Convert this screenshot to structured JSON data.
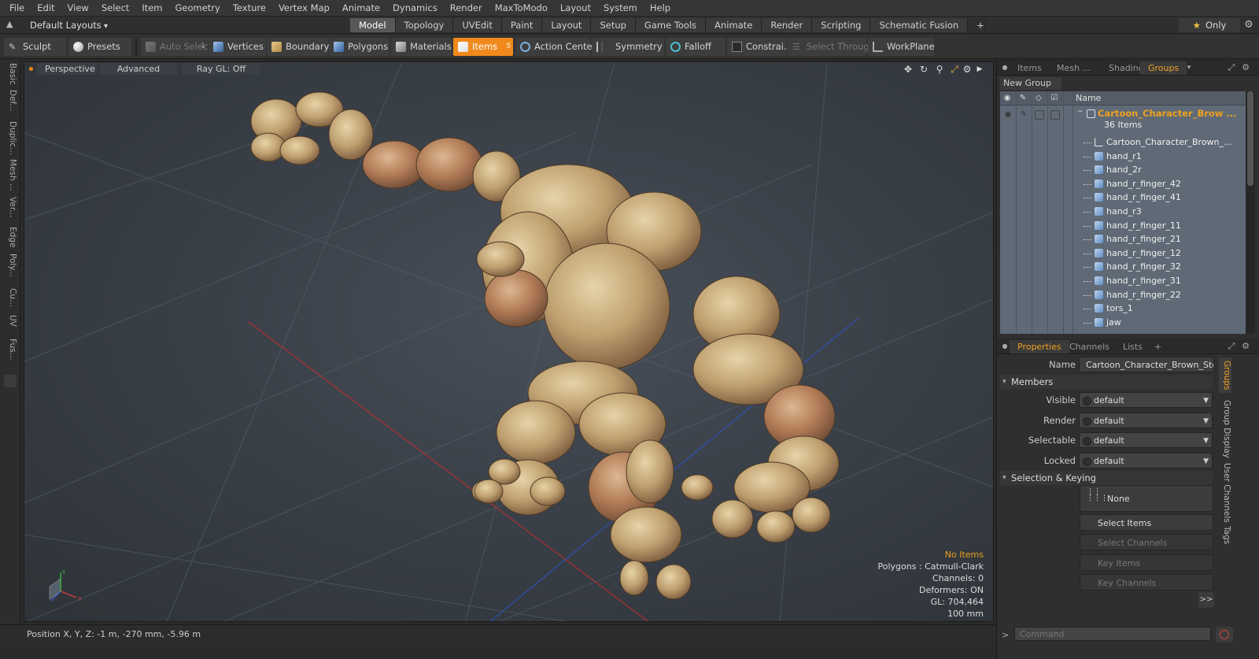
{
  "menubar": [
    "File",
    "Edit",
    "View",
    "Select",
    "Item",
    "Geometry",
    "Texture",
    "Vertex Map",
    "Animate",
    "Dynamics",
    "Render",
    "MaxToModo",
    "Layout",
    "System",
    "Help"
  ],
  "layoutbar": {
    "layout_name": "Default Layouts",
    "tabs": [
      "Model",
      "Topology",
      "UVEdit",
      "Paint",
      "Layout",
      "Setup",
      "Game Tools",
      "Animate",
      "Render",
      "Scripting",
      "Schematic Fusion"
    ],
    "active_tab": "Model",
    "add_tab_label": "+",
    "only_label": "Only"
  },
  "toolbar": {
    "sculpt": "Sculpt",
    "presets": "Presets",
    "auto_select": "Auto Select",
    "auto_select_num": "1",
    "vertices": "Vertices",
    "boundary": "Boundary",
    "polygons": "Polygons",
    "materials": "Materials",
    "items": "Items",
    "items_num": "5",
    "action_center": "Action Center",
    "symmetry": "Symmetry",
    "falloff": "Falloff",
    "constraints": "Constrai...",
    "select_through": "Select Through",
    "workplane": "WorkPlane"
  },
  "left_tabs": [
    "Basic",
    "Def...",
    "Duplic...",
    "Mesh ...",
    "Ver...",
    "Edge",
    "Poly...",
    "Cu...",
    "UV",
    "Fus..."
  ],
  "viewport": {
    "view_mode": "Perspective",
    "shading": "Advanced",
    "raygl": "Ray GL: Off",
    "stats": {
      "selection": "No Items",
      "polygons": "Polygons : Catmull-Clark",
      "channels": "Channels: 0",
      "deformers": "Deformers: ON",
      "gl": "GL: 704,464",
      "grid": "100 mm"
    },
    "axis_y": "Y",
    "axis_x": "X",
    "colors": {
      "grid_red": "#b03030",
      "grid_blue": "#3050b0",
      "stone_light": "#d8c49a",
      "stone_dark": "#8a6a4a"
    }
  },
  "statusbar": {
    "position": "Position X, Y, Z:   -1 m, -270 mm, -5.96 m"
  },
  "right_panel": {
    "top_tabs": [
      "Items",
      "Mesh ...",
      "Shading",
      "Groups"
    ],
    "active_top_tab": "Groups",
    "new_group": "New Group",
    "name_col": "Name",
    "group": {
      "name": "Cartoon_Character_Brow ...",
      "count": "36 Items",
      "items": [
        "Cartoon_Character_Brown_...",
        "hand_r1",
        "hand_2r",
        "hand_r_finger_42",
        "hand_r_finger_41",
        "hand_r3",
        "hand_r_finger_11",
        "hand_r_finger_21",
        "hand_r_finger_12",
        "hand_r_finger_32",
        "hand_r_finger_31",
        "hand_r_finger_22",
        "tors_1",
        "jaw"
      ]
    },
    "prop_tabs": [
      "Properties",
      "Channels",
      "Lists"
    ],
    "active_prop_tab": "Properties",
    "add_tab": "+",
    "properties": {
      "name_label": "Name",
      "name_value": "Cartoon_Character_Brown_Stone",
      "members_header": "Members",
      "visible_label": "Visible",
      "visible_value": "default",
      "render_label": "Render",
      "render_value": "default",
      "selectable_label": "Selectable",
      "selectable_value": "default",
      "locked_label": "Locked",
      "locked_value": "default",
      "selkey_header": "Selection & Keying",
      "none_label": "None",
      "select_items": "Select Items",
      "select_channels": "Select Channels",
      "key_items": "Key Items",
      "key_channels": "Key Channels",
      "expand": ">>"
    },
    "side_tabs": [
      "Groups",
      "Group Display",
      "User Channels",
      "Tags"
    ],
    "command_placeholder": "Command",
    "command_prompt": ">"
  }
}
